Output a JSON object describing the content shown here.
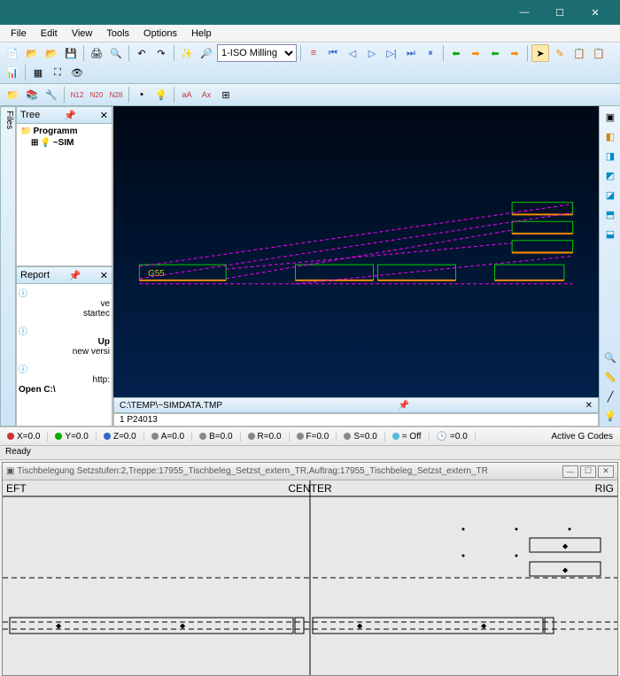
{
  "window": {
    "min": "—",
    "max": "☐",
    "close": "✕"
  },
  "menu": [
    "File",
    "Edit",
    "View",
    "Tools",
    "Options",
    "Help"
  ],
  "toolbar": {
    "operation_select": "1-ISO Milling"
  },
  "tree": {
    "title": "Tree",
    "tab": "Files",
    "items": [
      {
        "label": "Programm",
        "bold": true
      },
      {
        "label": "~SIM",
        "bold": true,
        "indent": 1
      }
    ]
  },
  "report": {
    "title": "Report",
    "lines": [
      "ve",
      "startec",
      "",
      "Up",
      "new versi",
      "",
      "http:",
      "Open C:\\"
    ]
  },
  "viewport": {
    "g_label": "G55",
    "file_path": "C:\\TEMP\\~SIMDATA.TMP",
    "code_line": "1  P24013"
  },
  "coords": {
    "X": "X=0.0",
    "Y": "Y=0.0",
    "Z": "Z=0.0",
    "A": "A=0.0",
    "B": "B=0.0",
    "R": "R=0.0",
    "F": "F=0.0",
    "S": "S=0.0",
    "cool": "= Off",
    "time": "=0.0",
    "active": "Active G Codes"
  },
  "status": "Ready",
  "subwin": {
    "title": "Tischbelegung Setzstufen:2,Treppe:17955_Tischbeleg_Setzst_extern_TR,Auftrag:17955_Tischbeleg_Setzst_extern_TR",
    "left": "EFT",
    "center": "CENTER",
    "right": "RIG"
  },
  "colors": {
    "accent": "#1b6d72",
    "magenta": "#ff00ff",
    "green": "#00d000",
    "orange": "#ff9000"
  }
}
